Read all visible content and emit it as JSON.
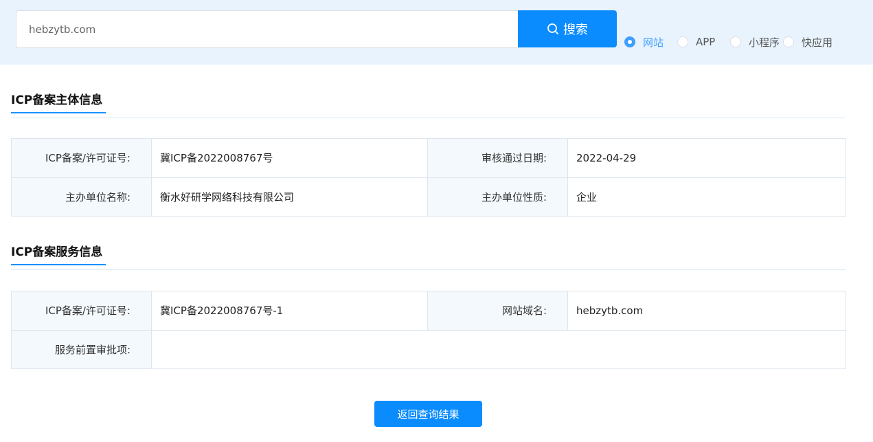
{
  "search": {
    "value": "hebzytb.com",
    "button_label": "搜索"
  },
  "types": [
    {
      "label": "网站",
      "selected": true
    },
    {
      "label": "APP",
      "selected": false
    },
    {
      "label": "小程序",
      "selected": false
    },
    {
      "label": "快应用",
      "selected": false
    }
  ],
  "subject": {
    "title": "ICP备案主体信息",
    "rows": [
      [
        {
          "label": "ICP备案/许可证号:",
          "value": "冀ICP备2022008767号"
        },
        {
          "label": "审核通过日期:",
          "value": "2022-04-29"
        }
      ],
      [
        {
          "label": "主办单位名称:",
          "value": "衡水好研学网络科技有限公司"
        },
        {
          "label": "主办单位性质:",
          "value": "企业"
        }
      ]
    ]
  },
  "service": {
    "title": "ICP备案服务信息",
    "rows": [
      [
        {
          "label": "ICP备案/许可证号:",
          "value": "冀ICP备2022008767号-1"
        },
        {
          "label": "网站域名:",
          "value": "hebzytb.com"
        }
      ],
      [
        {
          "label": "服务前置审批项:",
          "value": ""
        }
      ]
    ]
  },
  "back_button_label": "返回查询结果",
  "colors": {
    "accent": "#0a8cff",
    "band": "#e8f3fd",
    "label_bg": "#f4f9fd"
  }
}
